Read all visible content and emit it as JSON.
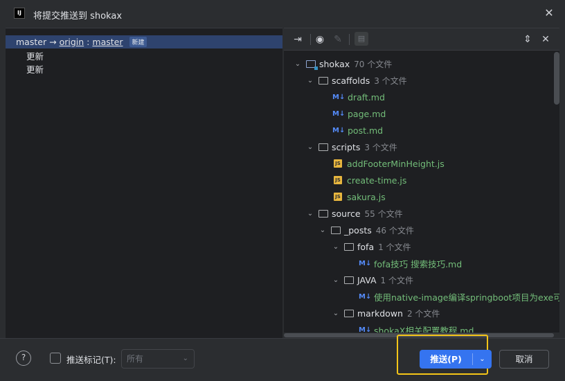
{
  "window": {
    "app_icon_text": "IJ",
    "title": "将提交推送到 shokax",
    "close_glyph": "✕"
  },
  "left": {
    "branch": {
      "local": "master",
      "arrow": "→",
      "remote": "origin",
      "colon": ":",
      "target": "master",
      "badge": "新建"
    },
    "commits": [
      "更新",
      "更新"
    ]
  },
  "toolbar": {
    "icons": [
      "collapse-icon",
      "eye-icon",
      "edit-icon",
      "diff-box-icon",
      "expand-all-icon",
      "collapse-all-icon"
    ]
  },
  "tree": [
    {
      "label": "shokax",
      "count": "70 个文件",
      "type": "module"
    },
    {
      "label": "scaffolds",
      "count": "3 个文件",
      "type": "dir"
    },
    {
      "label": "draft.md",
      "type": "md"
    },
    {
      "label": "page.md",
      "type": "md"
    },
    {
      "label": "post.md",
      "type": "md"
    },
    {
      "label": "scripts",
      "count": "3 个文件",
      "type": "dir"
    },
    {
      "label": "addFooterMinHeight.js",
      "type": "js"
    },
    {
      "label": "create-time.js",
      "type": "js"
    },
    {
      "label": "sakura.js",
      "type": "js"
    },
    {
      "label": "source",
      "count": "55 个文件",
      "type": "dir"
    },
    {
      "label": "_posts",
      "count": "46 个文件",
      "type": "dir"
    },
    {
      "label": "fofa",
      "count": "1 个文件",
      "type": "dir"
    },
    {
      "label": "fofa技巧 搜索技巧.md",
      "type": "md"
    },
    {
      "label": "JAVA",
      "count": "1 个文件",
      "type": "dir"
    },
    {
      "label": "使用native-image编译springboot项目为exe可执行",
      "type": "md"
    },
    {
      "label": "markdown",
      "count": "2 个文件",
      "type": "dir"
    },
    {
      "label": "shokaX相关配置教程.md",
      "type": "md"
    }
  ],
  "footer": {
    "help": "?",
    "checkbox_label": "推送标记(T):",
    "select_value": "所有",
    "push_label": "推送(P)",
    "cancel_label": "取消"
  }
}
